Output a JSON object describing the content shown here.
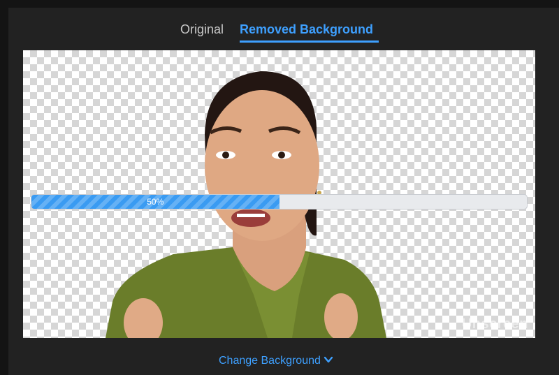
{
  "tabs": {
    "original_label": "Original",
    "removed_label": "Removed Background",
    "active": "Removed Background"
  },
  "progress": {
    "label": "50%",
    "value": 0.5
  },
  "watermark": {
    "text": "Unscreen"
  },
  "actions": {
    "change_background_label": "Change Background",
    "change_background_icon": "chevron-down-icon"
  },
  "colors": {
    "accent": "#3ea0ff",
    "background": "#222222",
    "progress_fill": "#3a9bf2",
    "progress_track": "#e8eaed"
  }
}
